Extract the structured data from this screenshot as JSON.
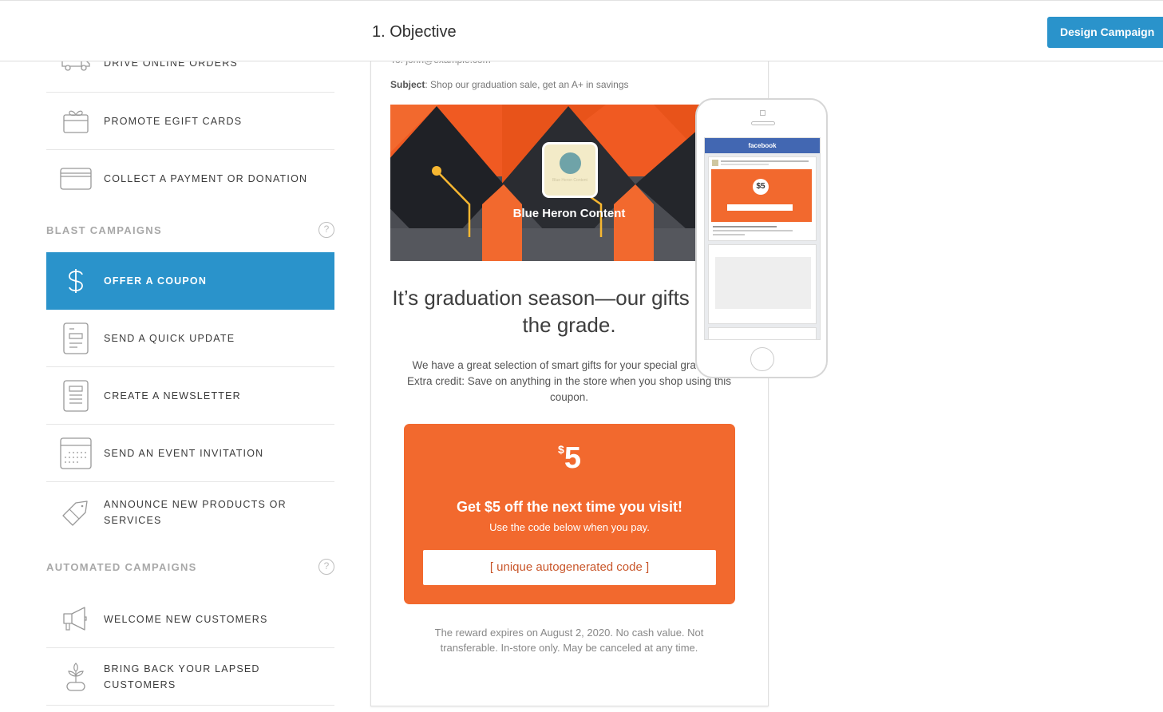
{
  "header": {
    "title": "1. Objective",
    "design_button": "Design Campaign"
  },
  "colors": {
    "accent_blue": "#2a93cb",
    "coupon_orange": "#f2692e",
    "facebook_blue": "#4267b2"
  },
  "sidebar": {
    "top_items": [
      {
        "label": "DRIVE ONLINE ORDERS",
        "icon": "delivery-truck-icon"
      },
      {
        "label": "PROMOTE EGIFT CARDS",
        "icon": "gift-card-icon"
      },
      {
        "label": "COLLECT A PAYMENT OR DONATION",
        "icon": "credit-card-icon"
      }
    ],
    "blast_section": {
      "title": "BLAST CAMPAIGNS",
      "help": "?",
      "items": [
        {
          "label": "OFFER A COUPON",
          "icon": "dollar-icon",
          "active": true
        },
        {
          "label": "SEND A QUICK UPDATE",
          "icon": "document-icon"
        },
        {
          "label": "CREATE A NEWSLETTER",
          "icon": "newsletter-icon"
        },
        {
          "label": "SEND AN EVENT INVITATION",
          "icon": "calendar-icon"
        },
        {
          "label": "ANNOUNCE NEW PRODUCTS OR SERVICES",
          "icon": "tag-icon"
        }
      ]
    },
    "automated_section": {
      "title": "AUTOMATED CAMPAIGNS",
      "help": "?",
      "items": [
        {
          "label": "WELCOME NEW CUSTOMERS",
          "icon": "megaphone-icon"
        },
        {
          "label": "BRING BACK YOUR LAPSED CUSTOMERS",
          "icon": "plant-icon"
        }
      ]
    }
  },
  "email": {
    "to": "To: john@example.com",
    "subject_label": "Subject",
    "subject": ": Shop our graduation sale, get an A+ in savings",
    "banner_title": "Blue Heron Content",
    "logo_text": "Blue Heron Content",
    "headline": "It’s graduation season—our gifts make the grade.",
    "body": "We have a great selection of smart gifts for your special graduate. Extra credit: Save on anything in the store when you shop using this coupon.",
    "coupon": {
      "currency": "$",
      "amount": "5",
      "line1": "Get $5 off the next time you visit!",
      "line2": "Use the code below when you pay.",
      "code": "[ unique autogenerated code ]"
    },
    "terms": "The reward expires on August 2, 2020. No cash value. Not transferable. In-store only. May be canceled at any time."
  },
  "phone_preview": {
    "app_bar": "facebook",
    "coupon_amount": "$5"
  }
}
